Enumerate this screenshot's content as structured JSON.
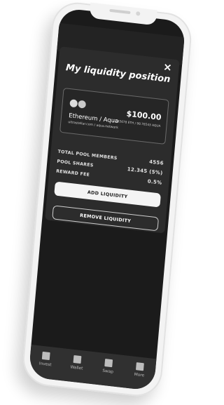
{
  "modal": {
    "close_glyph": "×",
    "title": "My liquidity position",
    "position_card": {
      "pair": "Ethereum / Aqua",
      "provider": "ultrastellar.com / aqua.network",
      "value": "$100.00",
      "amounts": "123.45678 ETH / 98.76543 AQUA"
    },
    "stats": [
      {
        "label": "TOTAL POOL MEMBERS",
        "value": "4556"
      },
      {
        "label": "POOL SHARES",
        "value": "12.345 (5%)"
      },
      {
        "label": "REWARD FEE",
        "value": "0.5%"
      }
    ],
    "add_button": "ADD LIQUIDITY",
    "remove_button": "REMOVE LIQUIDITY"
  },
  "tabbar": {
    "items": [
      {
        "label": "Invest",
        "icon": "invest-icon"
      },
      {
        "label": "Wallet",
        "icon": "wallet-icon"
      },
      {
        "label": "Swap",
        "icon": "swap-icon"
      },
      {
        "label": "More",
        "icon": "more-icon"
      }
    ]
  }
}
